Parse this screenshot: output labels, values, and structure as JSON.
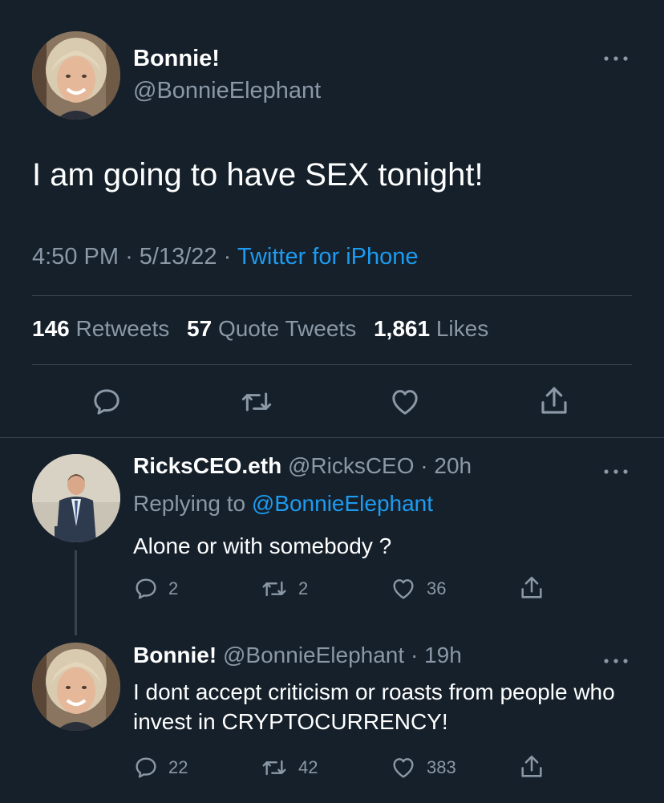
{
  "main_tweet": {
    "display_name": "Bonnie!",
    "handle": "@BonnieElephant",
    "text": "I am going to have SEX tonight!",
    "time": "4:50 PM",
    "separator": "·",
    "date": "5/13/22",
    "source": "Twitter for iPhone",
    "retweets_count": "146",
    "retweets_label": "Retweets",
    "quotes_count": "57",
    "quotes_label": "Quote Tweets",
    "likes_count": "1,861",
    "likes_label": "Likes",
    "more_icon": "more-horizontal-icon"
  },
  "replies": [
    {
      "display_name": "RicksCEO.eth",
      "handle": "@RicksCEO",
      "separator": "·",
      "time": "20h",
      "replying_label": "Replying to",
      "replying_to": "@BonnieElephant",
      "text": "Alone or with somebody ?",
      "reply_count": "2",
      "retweet_count": "2",
      "like_count": "36"
    },
    {
      "display_name": "Bonnie!",
      "handle": "@BonnieElephant",
      "separator": "·",
      "time": "19h",
      "text": "I dont accept criticism or roasts from people who invest in CRYPTOCURRENCY!",
      "reply_count": "22",
      "retweet_count": "42",
      "like_count": "383"
    }
  ],
  "colors": {
    "background": "#15202b",
    "accent": "#1d9bf0",
    "secondary_text": "#8b98a5",
    "divider": "#38444d"
  }
}
